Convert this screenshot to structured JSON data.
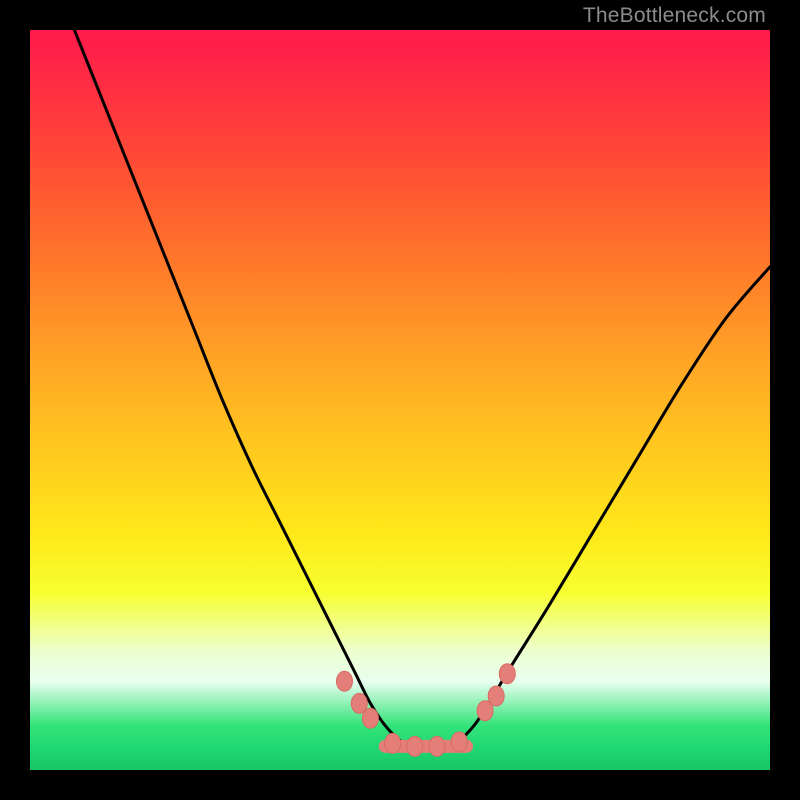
{
  "watermark": "TheBottleneck.com",
  "colors": {
    "frame": "#000000",
    "curve": "#000000",
    "marker_fill": "#e37f78",
    "marker_stroke": "#d86a63"
  },
  "chart_data": {
    "type": "line",
    "title": "",
    "xlabel": "",
    "ylabel": "",
    "xlim": [
      0,
      100
    ],
    "ylim": [
      0,
      100
    ],
    "grid": false,
    "legend": false,
    "annotations": [],
    "series": [
      {
        "name": "bottleneck-curve",
        "x": [
          6,
          10,
          14,
          18,
          22,
          26,
          30,
          34,
          38,
          41,
          44,
          46,
          48,
          50,
          52,
          54,
          56,
          58,
          60,
          62,
          65,
          70,
          76,
          82,
          88,
          94,
          100
        ],
        "y": [
          100,
          90,
          80,
          70,
          60,
          50,
          41,
          33,
          25,
          19,
          13,
          9,
          6,
          4,
          3,
          3,
          3,
          4,
          6,
          9,
          14,
          22,
          32,
          42,
          52,
          61,
          68
        ]
      }
    ],
    "markers": [
      {
        "x": 42.5,
        "y": 12
      },
      {
        "x": 44.5,
        "y": 9
      },
      {
        "x": 46.0,
        "y": 7
      },
      {
        "x": 49.0,
        "y": 3.6
      },
      {
        "x": 52.0,
        "y": 3.2
      },
      {
        "x": 55.0,
        "y": 3.2
      },
      {
        "x": 58.0,
        "y": 3.8
      },
      {
        "x": 61.5,
        "y": 8
      },
      {
        "x": 63.0,
        "y": 10
      },
      {
        "x": 64.5,
        "y": 13
      }
    ],
    "flat_segment": {
      "x1": 48,
      "x2": 59,
      "y": 3.2
    }
  }
}
